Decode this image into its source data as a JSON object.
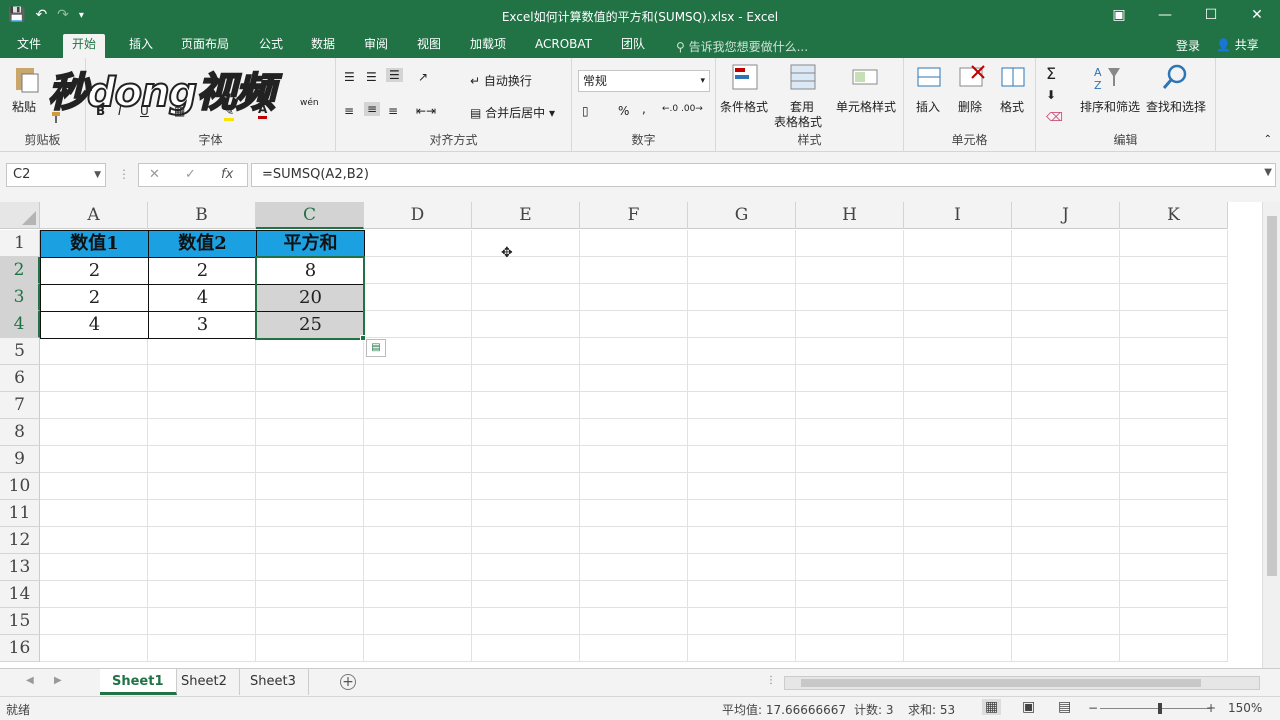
{
  "titlebar": {
    "title": "Excel如何计算数值的平方和(SUMSQ).xlsx - Excel",
    "min_glyph": "—",
    "max_glyph": "☐",
    "close_glyph": "✕"
  },
  "tabs": [
    "文件",
    "开始",
    "插入",
    "页面布局",
    "公式",
    "数据",
    "审阅",
    "视图",
    "加载项",
    "ACROBAT",
    "团队"
  ],
  "active_tab": "开始",
  "tell_me": "告诉我您想要做什么...",
  "login": "登录",
  "share": "共享",
  "watermark": "秒dong视频",
  "ribbon": {
    "clipboard": {
      "label": "剪贴板",
      "paste": "粘贴"
    },
    "font": {
      "label": "字体",
      "bold": "B",
      "italic": "I",
      "underline": "U",
      "color_a": "A",
      "wen": "wén"
    },
    "align": {
      "label": "对齐方式",
      "wrap": "自动换行",
      "merge": "合并后居中"
    },
    "number": {
      "label": "数字",
      "format": "常规",
      "percent": "%",
      "comma": ","
    },
    "styles": {
      "label": "样式",
      "cond": "条件格式",
      "table1": "套用",
      "table2": "表格格式",
      "cell": "单元格样式"
    },
    "cells": {
      "label": "单元格",
      "insert": "插入",
      "delete": "删除",
      "format": "格式"
    },
    "editing": {
      "label": "编辑",
      "sigma": "Σ",
      "sort": "排序和筛选",
      "find": "查找和选择"
    }
  },
  "formula_bar": {
    "name_box": "C2",
    "formula": "=SUMSQ(A2,B2)",
    "fx": "fx"
  },
  "columns": [
    "A",
    "B",
    "C",
    "D",
    "E",
    "F",
    "G",
    "H",
    "I",
    "J",
    "K"
  ],
  "rows": [
    "1",
    "2",
    "3",
    "4",
    "5",
    "6",
    "7",
    "8",
    "9",
    "10",
    "11",
    "12",
    "13",
    "14",
    "15",
    "16"
  ],
  "table": {
    "headers": [
      "数值1",
      "数值2",
      "平方和"
    ],
    "rows": [
      [
        "2",
        "2",
        "8"
      ],
      [
        "2",
        "4",
        "20"
      ],
      [
        "4",
        "3",
        "25"
      ]
    ]
  },
  "sheets": [
    "Sheet1",
    "Sheet2",
    "Sheet3"
  ],
  "status": {
    "ready": "就绪",
    "average": "平均值: 17.66666667",
    "count": "计数: 3",
    "sum": "求和: 53",
    "zoom": "150%"
  }
}
